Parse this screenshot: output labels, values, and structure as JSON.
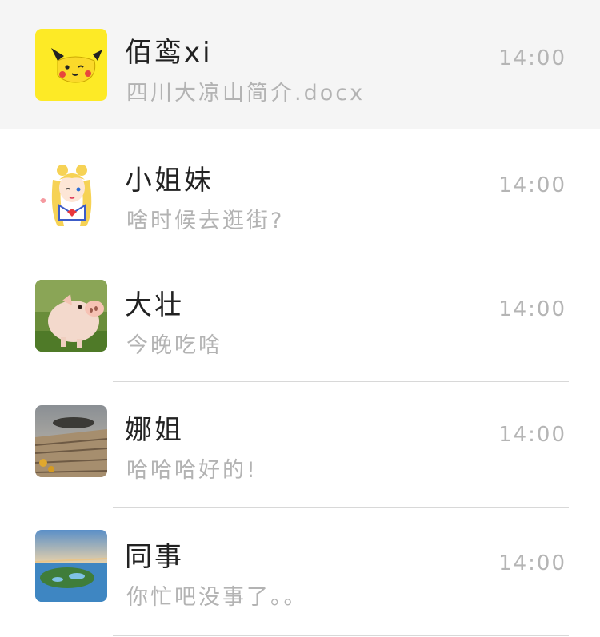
{
  "conversations": [
    {
      "name": "佰鸾xi",
      "preview": "四川大凉山简介.docx",
      "time": "14:00",
      "pinned": true,
      "avatar": "pikachu-avatar"
    },
    {
      "name": "小姐妹",
      "preview": "啥时候去逛街?",
      "time": "14:00",
      "pinned": false,
      "avatar": "sailor-moon-avatar"
    },
    {
      "name": "大壮",
      "preview": "今晚吃啥",
      "time": "14:00",
      "pinned": false,
      "avatar": "piglet-avatar"
    },
    {
      "name": "娜姐",
      "preview": "哈哈哈好的!",
      "time": "14:00",
      "pinned": false,
      "avatar": "wooden-planks-avatar"
    },
    {
      "name": "同事",
      "preview": "你忙吧没事了。。",
      "time": "14:00",
      "pinned": false,
      "avatar": "lake-landscape-avatar"
    }
  ],
  "colors": {
    "pinned_background": "#f5f5f5",
    "name_text": "#222222",
    "preview_text": "#b3b3b3",
    "time_text": "#b5b5b5",
    "divider": "#d8d8d8"
  }
}
